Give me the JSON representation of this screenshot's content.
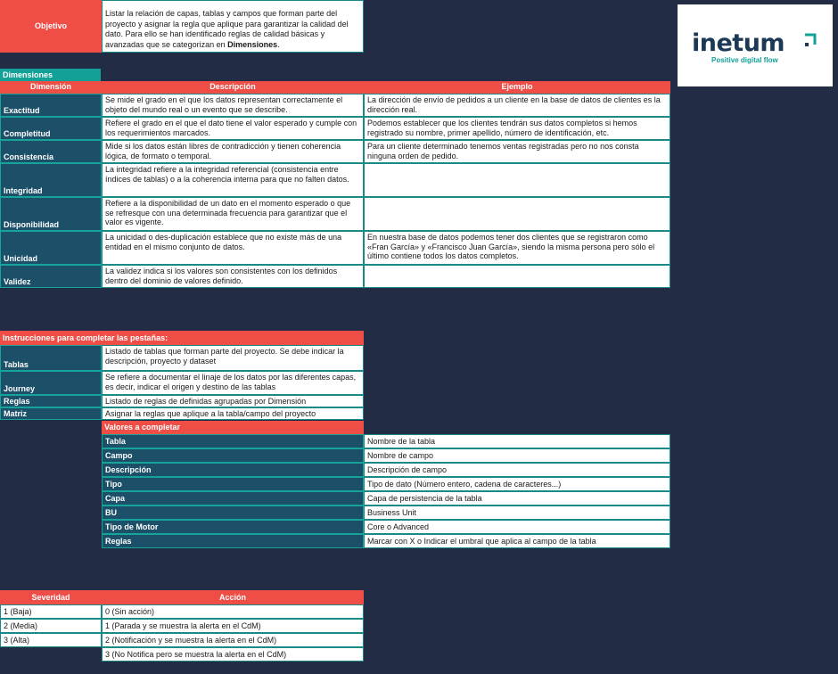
{
  "objetivo": {
    "label": "Objetivo",
    "text_1": "Listar la relación de capas, tablas y campos que forman parte del proyecto y asignar la regla que aplique para garantizar la calidad del dato. Para ello se han identificado reglas de calidad básicas y avanzadas que se categorizan en ",
    "text_bold": "Dimensiones",
    "text_end": "."
  },
  "logo": {
    "name": "inetum",
    "tagline": "Positive digital flow"
  },
  "dimensiones": {
    "section_title": "Dimensiones",
    "headers": [
      "Dimensión",
      "Descripción",
      "Ejemplo"
    ],
    "rows": [
      {
        "name": "Exactitud",
        "description": "Se mide el grado en el que los datos representan correctamente el objeto del mundo real o un evento que se describe.",
        "example": "La dirección de envío de pedidos a un cliente en la base de datos de clientes es la dirección real."
      },
      {
        "name": "Completitud",
        "description": "Refiere el grado en el que el dato tiene el valor esperado y cumple con los requerimientos marcados.",
        "example": "Podemos establecer que los clientes tendrán sus datos completos si hemos registrado su nombre, primer apellido, número de identificación, etc."
      },
      {
        "name": "Consistencia",
        "description": "Mide si los datos están libres de contradicción y tienen coherencia lógica, de formato o temporal.",
        "example": "Para un cliente determinado tenemos ventas registradas pero no nos consta ninguna orden de pedido."
      },
      {
        "name": "Integridad",
        "description": "La integridad refiere a la integridad referencial (consistencia entre índices de tablas) o a la coherencia interna para que no falten datos.",
        "example": ""
      },
      {
        "name": "Disponibilidad",
        "description": "Refiere a la disponibilidad de un dato en el momento esperado o que se refresque con una determinada frecuencia para garantizar que el valor es vigente.",
        "example": ""
      },
      {
        "name": "Unicidad",
        "description": "La unicidad o des-duplicación establece que no existe más de una entidad en el mismo conjunto de datos.",
        "example": "En nuestra base de datos podemos tener dos clientes que se registraron como «Fran García» y «Francisco Juan García», siendo la misma persona pero sólo el último contiene todos los datos completos."
      },
      {
        "name": "Validez",
        "description": "La validez indica si los valores son consistentes con los definidos dentro del dominio de valores definido.",
        "example": ""
      }
    ]
  },
  "instrucciones": {
    "title": "Instrucciones para completar las pestañas:",
    "rows": [
      {
        "name": "Tablas",
        "text": "Listado de tablas que forman parte del proyecto. Se debe indicar la descripción, proyecto y dataset"
      },
      {
        "name": "Journey",
        "text": "Se refiere a documentar el linaje de los datos por las diferentes capas, es decir, indicar el origen y destino de las tablas"
      },
      {
        "name": "Reglas",
        "text": "Listado de reglas de definidas agrupadas por Dimensión"
      },
      {
        "name": "Matriz",
        "text": "Asignar la reglas que aplique a la tabla/campo del proyecto"
      }
    ]
  },
  "valores": {
    "title": "Valores a completar",
    "rows": [
      {
        "name": "Tabla",
        "text": "Nombre de la tabla"
      },
      {
        "name": "Campo",
        "text": "Nombre de campo"
      },
      {
        "name": "Descripción",
        "text": "Descripción de campo"
      },
      {
        "name": "Tipo",
        "text": "Tipo de dato (Número entero, cadena de caracteres...)"
      },
      {
        "name": "Capa",
        "text": "Capa de persistencia de la tabla"
      },
      {
        "name": "BU",
        "text": "Business Unit"
      },
      {
        "name": "Tipo de Motor",
        "text": "Core o Advanced"
      },
      {
        "name": "Reglas",
        "text": "Marcar con X o Indicar el umbral que aplica al campo de la tabla"
      }
    ]
  },
  "severidad": {
    "headers": [
      "Severidad",
      "Acción"
    ],
    "severities": [
      "1 (Baja)",
      "2 (Media)",
      "3 (Alta)",
      ""
    ],
    "actions": [
      "0 (Sin acción)",
      "1 (Parada y se muestra la alerta en el CdM)",
      "2 (Notificación y se muestra la alerta en el CdM)",
      "3 (No Notifica pero se muestra la alerta en el CdM)"
    ]
  },
  "colors": {
    "background": "#232c45",
    "red": "#ef4e47",
    "navy": "#1c4f68",
    "teal": "#13a197"
  }
}
